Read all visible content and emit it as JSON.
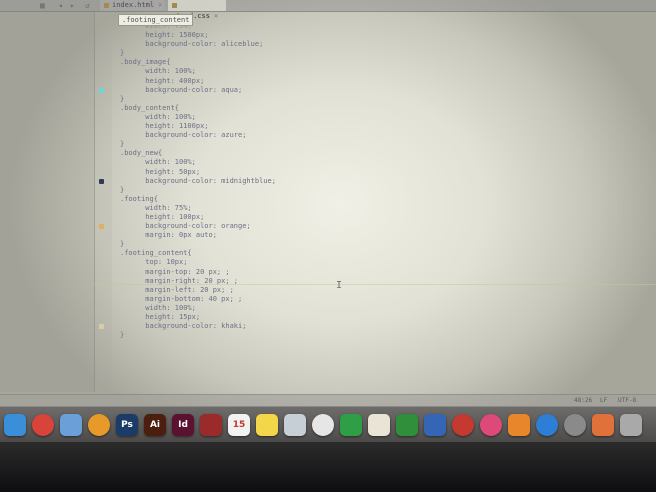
{
  "tabs": [
    {
      "label": "index.html"
    },
    {
      "label": "stand.css"
    }
  ],
  "autocomplete_badge": ".footing_content",
  "code_lines": [
    "      width: 75%;",
    "      height: 1500px;",
    "      background-color: aliceblue;",
    "}",
    ".body_image{",
    "      width: 100%;",
    "      height: 400px;",
    "      background-color: aqua;",
    "}",
    ".body_content{",
    "      width: 100%;",
    "      height: 1100px;",
    "      background-color: azure;",
    "}",
    ".body_new{",
    "      width: 100%;",
    "      height: 50px;",
    "      background-color: midnightblue;",
    "}",
    ".footing{",
    "      width: 75%;",
    "      height: 100px;",
    "      background-color: orange;",
    "      margin: 0px auto;",
    "}",
    ".footing_content{",
    "      top: 10px;",
    "      margin-top: 20 px; ;",
    "      margin-right: 20 px; ;",
    "      margin-left: 20 px; ;",
    "      margin-bottom: 40 px; ;",
    "      width: 100%;",
    "      height: 15px;",
    "      background-color: khaki;",
    "}"
  ],
  "gutter_markers": [
    {
      "line": 7,
      "color": "#6fd6d6"
    },
    {
      "line": 17,
      "color": "#2d3b57"
    },
    {
      "line": 22,
      "color": "#e0b060"
    },
    {
      "line": 33,
      "color": "#d8cfa0"
    }
  ],
  "status": {
    "position": "48:26",
    "line_ending": "LF",
    "encoding": "UTF-8"
  },
  "dock_apps": [
    {
      "name": "finder",
      "label": "",
      "color": "#3b8ed8",
      "round": false
    },
    {
      "name": "chrome",
      "label": "",
      "color": "#d9443a",
      "round": true
    },
    {
      "name": "mail",
      "label": "",
      "color": "#6a9fd8",
      "round": false
    },
    {
      "name": "wifi",
      "label": "",
      "color": "#e79a2a",
      "round": true
    },
    {
      "name": "photoshop",
      "label": "Ps",
      "color": "#1c3c68",
      "round": false
    },
    {
      "name": "illustrator",
      "label": "Ai",
      "color": "#4b1e10",
      "round": false
    },
    {
      "name": "indesign",
      "label": "Id",
      "color": "#5a1230",
      "round": false
    },
    {
      "name": "photobooth",
      "label": "",
      "color": "#9b2b2b",
      "round": false
    },
    {
      "name": "calendar",
      "label": "15",
      "color": "#f2f2f2",
      "round": false
    },
    {
      "name": "notes",
      "label": "",
      "color": "#f3d64a",
      "round": false
    },
    {
      "name": "preview",
      "label": "",
      "color": "#c7cfd6",
      "round": false
    },
    {
      "name": "photos",
      "label": "",
      "color": "#e6e6e6",
      "round": true
    },
    {
      "name": "facetime",
      "label": "",
      "color": "#2f9f47",
      "round": false
    },
    {
      "name": "textedit",
      "label": "",
      "color": "#e9e4d6",
      "round": false
    },
    {
      "name": "numbers",
      "label": "",
      "color": "#2f8f3a",
      "round": false
    },
    {
      "name": "keynote",
      "label": "",
      "color": "#3566b5",
      "round": false
    },
    {
      "name": "messages",
      "label": "",
      "color": "#c43a30",
      "round": true
    },
    {
      "name": "itunes",
      "label": "",
      "color": "#dd4a7a",
      "round": true
    },
    {
      "name": "ibooks",
      "label": "",
      "color": "#e8862c",
      "round": false
    },
    {
      "name": "appstore",
      "label": "",
      "color": "#2d7fd6",
      "round": true
    },
    {
      "name": "system-preferences",
      "label": "",
      "color": "#8a8a8a",
      "round": true
    },
    {
      "name": "sublime",
      "label": "",
      "color": "#e0713a",
      "round": false
    },
    {
      "name": "trash",
      "label": "",
      "color": "#a9a9a9",
      "round": false
    }
  ]
}
